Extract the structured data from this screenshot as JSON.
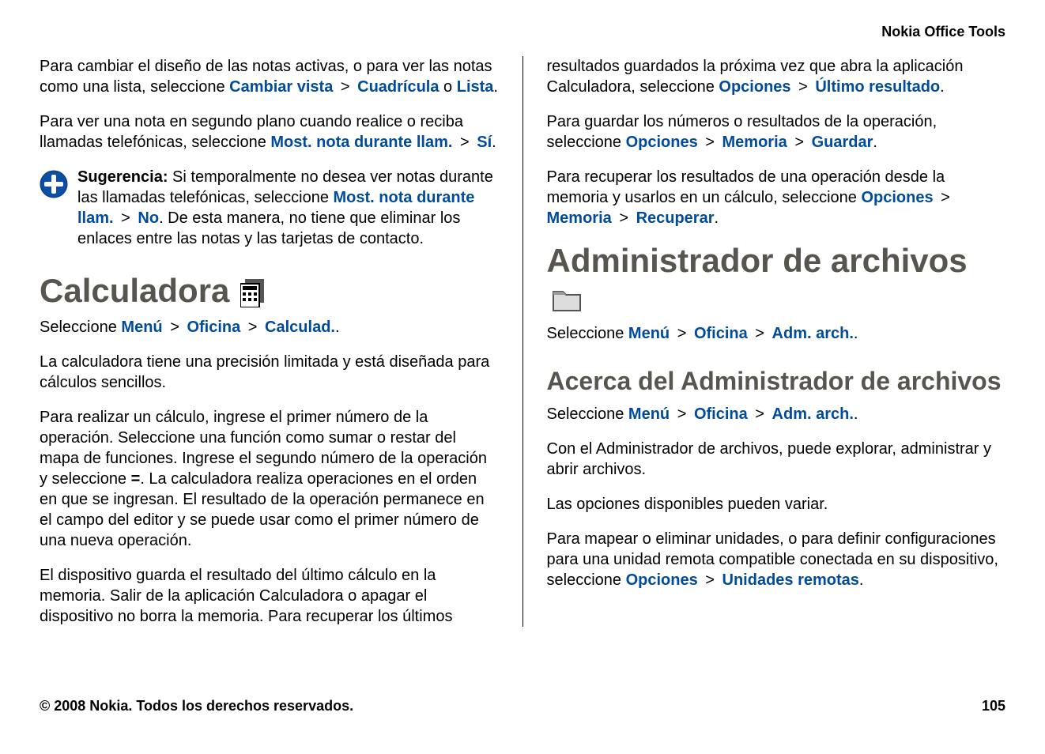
{
  "header": "Nokia Office Tools",
  "left": {
    "p1a": "Para cambiar el diseño de las notas activas, o para ver las notas como una lista, seleccione ",
    "p1_link1": "Cambiar vista",
    "p1_link2": "Cuadrícula",
    "p1_or": " o ",
    "p1_link3": "Lista",
    "p1_end": ".",
    "p2a": "Para ver una nota en segundo plano cuando realice o reciba llamadas telefónicas, seleccione ",
    "p2_link1": "Most. nota durante llam.",
    "p2_link2": "Sí",
    "p2_end": ".",
    "tip_bold": "Sugerencia: ",
    "tip_a": "Si temporalmente no desea ver notas durante las llamadas telefónicas, seleccione ",
    "tip_link1": "Most. nota durante llam.",
    "tip_link2": "No",
    "tip_b": ". De esta manera, no tiene que eliminar los enlaces entre las notas y las tarjetas de contacto.",
    "h_calc": "Calculadora",
    "calc_sel_a": "Seleccione ",
    "calc_sel_l1": "Menú",
    "calc_sel_l2": "Oficina",
    "calc_sel_l3": "Calculad.",
    "calc_sel_end": ".",
    "calc_p1": "La calculadora tiene una precisión limitada y está diseñada para cálculos sencillos.",
    "calc_p2a": "Para realizar un cálculo, ingrese el primer número de la operación. Seleccione una función como sumar o restar del mapa de funciones. Ingrese el segundo número de la operación y seleccione ",
    "calc_p2_eq": "=",
    "calc_p2b": ". La calculadora realiza operaciones en el orden en que se ingresan. El resultado de la operación permanece en el campo del editor y se puede usar como el primer número de una nueva operación.",
    "calc_p3": "El dispositivo guarda el resultado del último cálculo en la memoria. Salir de la aplicación Calculadora o apagar el dispositivo no borra la memoria. Para recuperar los últimos"
  },
  "right": {
    "p1a": "resultados guardados la próxima vez que abra la aplicación Calculadora, seleccione ",
    "p1_l1": "Opciones",
    "p1_l2": "Último resultado",
    "p1_end": ".",
    "p2a": "Para guardar los números o resultados de la operación, seleccione ",
    "p2_l1": "Opciones",
    "p2_l2": "Memoria",
    "p2_l3": "Guardar",
    "p2_end": ".",
    "p3a": "Para recuperar los resultados de una operación desde la memoria y usarlos en un cálculo, seleccione ",
    "p3_l1": "Opciones",
    "p3_l2": "Memoria",
    "p3_l3": "Recuperar",
    "p3_end": ".",
    "h_fm": "Administrador de archivos",
    "fm_sel_a": "Seleccione ",
    "fm_sel_l1": "Menú",
    "fm_sel_l2": "Oficina",
    "fm_sel_l3": "Adm. arch.",
    "fm_sel_end": ".",
    "h_about": "Acerca del Administrador de archivos",
    "about_sel_a": "Seleccione ",
    "about_sel_l1": "Menú",
    "about_sel_l2": "Oficina",
    "about_sel_l3": "Adm. arch.",
    "about_sel_end": ".",
    "about_p1": "Con el Administrador de archivos, puede explorar, administrar y abrir archivos.",
    "about_p2": "Las opciones disponibles pueden variar.",
    "about_p3a": "Para mapear o eliminar unidades, o para definir configuraciones para una unidad remota compatible conectada en su dispositivo, seleccione ",
    "about_p3_l1": "Opciones",
    "about_p3_l2": "Unidades remotas",
    "about_p3_end": "."
  },
  "footer": {
    "left": "© 2008 Nokia. Todos los derechos reservados.",
    "right": "105"
  }
}
